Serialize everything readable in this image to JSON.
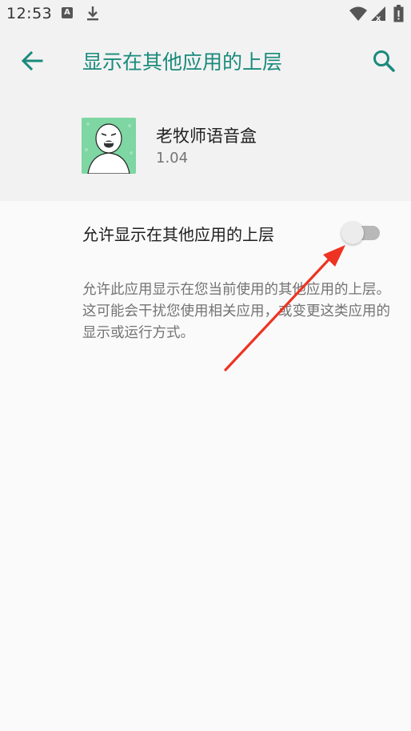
{
  "status_bar": {
    "time": "12:53",
    "notification_icons": [
      "a-icon",
      "download-icon"
    ],
    "system_icons": [
      "wifi-icon",
      "signal-icon",
      "battery-icon"
    ]
  },
  "app_bar": {
    "title": "显示在其他应用的上层",
    "back_icon": "arrow-back-icon",
    "search_icon": "search-icon",
    "accent_color": "#1a8a7c"
  },
  "app_header": {
    "name": "老牧师语音盒",
    "version": "1.04",
    "icon": "app-icon"
  },
  "permission": {
    "label": "允许显示在其他应用的上层",
    "toggle_state": "off",
    "description": "允许此应用显示在您当前使用的其他应用的上层。这可能会干扰您使用相关应用，或变更这类应用的显示或运行方式。"
  },
  "annotation": {
    "type": "arrow",
    "color": "#ee3322",
    "points_to": "toggle"
  }
}
